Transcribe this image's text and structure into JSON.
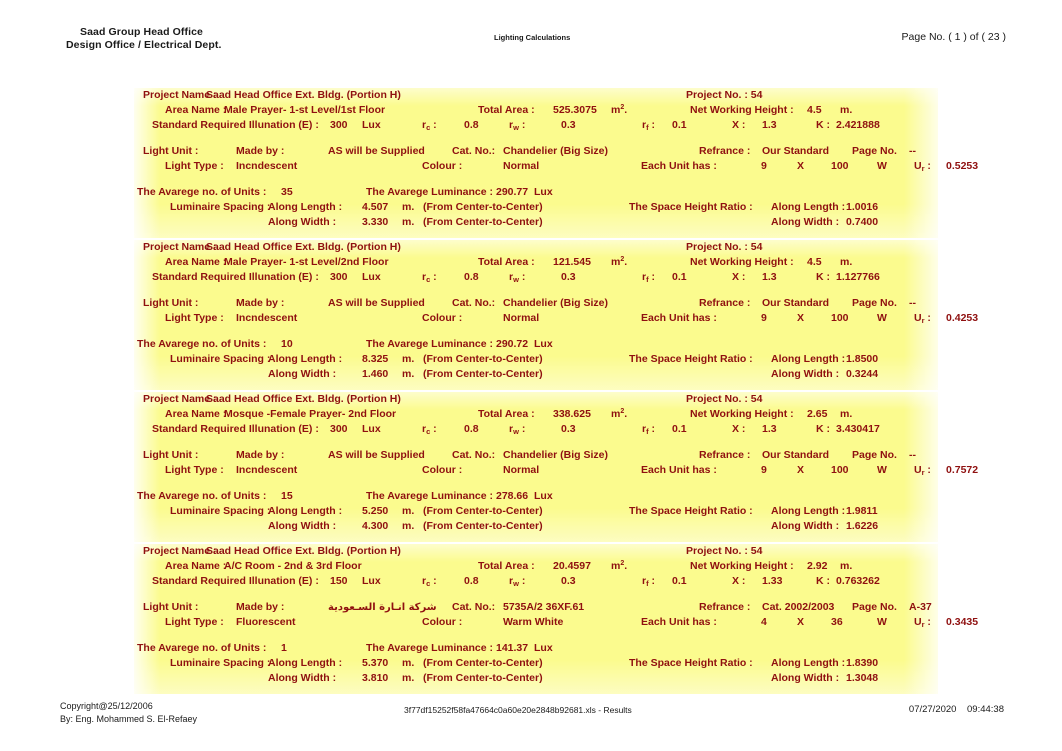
{
  "header": {
    "company_line1": "Saad Group Head Office",
    "company_line2": "Design Office / Electrical Dept.",
    "doc_title": "Lighting Calculations",
    "page_indicator": "Page No. ( 1 ) of ( 23 )"
  },
  "labels": {
    "project_name": "Project Name :",
    "project_no": "Project No. : 54",
    "area_name": "Area Name :",
    "total_area": "Total Area :",
    "unit_area": "m².",
    "net_working_height": "Net Working Height :",
    "unit_m": "m.",
    "standard_required_illunation": "Standard Required Illunation (E) :",
    "lux": "Lux",
    "rc": "r",
    "rc_sub": "c",
    "rc_colon": " :",
    "rw": "r",
    "rw_sub": "w",
    "rf": "r",
    "rf_sub": "f",
    "x": "X :",
    "k": "K :",
    "light_unit": "Light Unit :",
    "made_by": "Made by :",
    "cat_no": "Cat. No.:",
    "refrance": "Refrance :",
    "page_no": "Page No.",
    "light_type": "Light Type :",
    "colour": "Colour :",
    "each_unit_has": "Each Unit has :",
    "times": "X",
    "watt": "W",
    "ur": "U",
    "ur_sub": "r",
    "ur_colon": " :",
    "avg_units": "The Avarege no. of Units :",
    "avg_luminance": "The Avarege Luminance :",
    "luminaire_spacing": "Luminaire Spacing :",
    "along_length": "Along Length :",
    "along_width": "Along Width :",
    "center_to_center": "(From Center-to-Center)",
    "space_height_ratio": "The Space Height Ratio :"
  },
  "blocks": [
    {
      "project_name": "Saad Head Office Ext. Bldg. (Portion H)",
      "project_no": "Project No. : 54",
      "area_name": "Male Prayer- 1-st Level/1st Floor",
      "total_area": "525.3075",
      "net_working_height": "4.5",
      "illunation": "300",
      "rc": "0.8",
      "rw": "0.3",
      "rf": "0.1",
      "x": "1.3",
      "k": "2.421888",
      "made_by": "AS will be Supplied",
      "made_by_arabic": false,
      "cat_no": "Chandelier (Big Size)",
      "refrance": "Our Standard",
      "page_no": "--",
      "light_type": "Incndescent",
      "colour": "Normal",
      "lamps_per_unit": "9",
      "lamp_watt": "100",
      "ur": "0.5253",
      "avg_units": "35",
      "avg_luminance": "290.77",
      "spacing_length": "4.507",
      "spacing_width": "3.330",
      "shr_length": "1.0016",
      "shr_width": "0.7400"
    },
    {
      "project_name": "Saad Head Office Ext. Bldg. (Portion H)",
      "project_no": "Project No. : 54",
      "area_name": "Male Prayer- 1-st Level/2nd Floor",
      "total_area": "121.545",
      "net_working_height": "4.5",
      "illunation": "300",
      "rc": "0.8",
      "rw": "0.3",
      "rf": "0.1",
      "x": "1.3",
      "k": "1.127766",
      "made_by": "AS will be Supplied",
      "made_by_arabic": false,
      "cat_no": "Chandelier (Big Size)",
      "refrance": "Our Standard",
      "page_no": "--",
      "light_type": "Incndescent",
      "colour": "Normal",
      "lamps_per_unit": "9",
      "lamp_watt": "100",
      "ur": "0.4253",
      "avg_units": "10",
      "avg_luminance": "290.72",
      "spacing_length": "8.325",
      "spacing_width": "1.460",
      "shr_length": "1.8500",
      "shr_width": "0.3244"
    },
    {
      "project_name": "Saad Head Office Ext. Bldg. (Portion H)",
      "project_no": "Project No. : 54",
      "area_name": "Mosque -Female Prayer- 2nd Floor",
      "total_area": "338.625",
      "net_working_height": "2.65",
      "illunation": "300",
      "rc": "0.8",
      "rw": "0.3",
      "rf": "0.1",
      "x": "1.3",
      "k": "3.430417",
      "made_by": "AS will be Supplied",
      "made_by_arabic": false,
      "cat_no": "Chandelier (Big Size)",
      "refrance": "Our Standard",
      "page_no": "--",
      "light_type": "Incndescent",
      "colour": "Normal",
      "lamps_per_unit": "9",
      "lamp_watt": "100",
      "ur": "0.7572",
      "avg_units": "15",
      "avg_luminance": "278.66",
      "spacing_length": "5.250",
      "spacing_width": "4.300",
      "shr_length": "1.9811",
      "shr_width": "1.6226"
    },
    {
      "project_name": "Saad Head Office Ext. Bldg. (Portion H)",
      "project_no": "Project No. : 54",
      "area_name": "A/C Room - 2nd & 3rd Floor",
      "total_area": "20.4597",
      "net_working_height": "2.92",
      "illunation": "150",
      "rc": "0.8",
      "rw": "0.3",
      "rf": "0.1",
      "x": "1.33",
      "k": "0.763262",
      "made_by": "شركة انـارة السـعودية",
      "made_by_arabic": true,
      "cat_no": "5735A/2 36XF.61",
      "refrance": "Cat. 2002/2003",
      "page_no": "A-37",
      "light_type": "Fluorescent",
      "colour": "Warm White",
      "lamps_per_unit": "4",
      "lamp_watt": "36",
      "ur": "0.3435",
      "avg_units": "1",
      "avg_luminance": "141.37",
      "spacing_length": "5.370",
      "spacing_width": "3.810",
      "shr_length": "1.8390",
      "shr_width": "1.3048"
    }
  ],
  "footer": {
    "copyright": "Copyright@25/12/2006",
    "author": "By: Eng. Mohammed S. El-Refaey",
    "filename": "3f77df15252f58fa47664c0a60e20e2848b92681.xls - Results",
    "date": "07/27/2020",
    "time": "09:44:38"
  }
}
